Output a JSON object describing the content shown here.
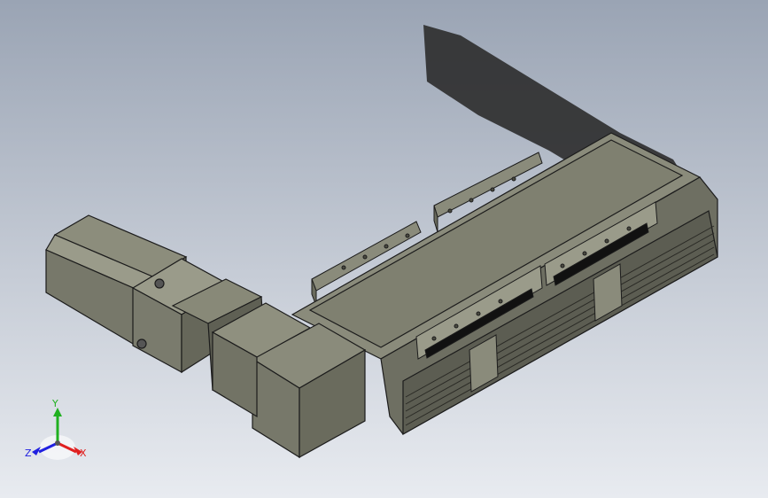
{
  "viewport": {
    "background_top": "#9aa4b4",
    "background_bottom": "#e8ebf0"
  },
  "model": {
    "body_color": "#7f8070",
    "edge_color": "#1c1c1c"
  },
  "triad": {
    "x_label": "X",
    "y_label": "Y",
    "z_label": "Z",
    "x_color": "#e02020",
    "y_color": "#20b020",
    "z_color": "#2020e0"
  }
}
